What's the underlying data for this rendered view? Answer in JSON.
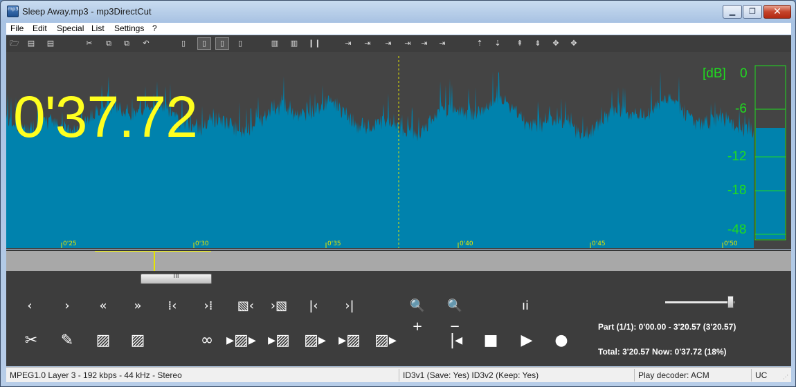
{
  "window": {
    "title": "Sleep Away.mp3 - mp3DirectCut",
    "icon_text": "mp3",
    "min_label": "▁",
    "max_label": "❐",
    "close_label": "✕"
  },
  "menu": [
    {
      "label": "File"
    },
    {
      "label": "Edit"
    },
    {
      "label": "Special"
    },
    {
      "label": "List"
    },
    {
      "label": "Settings"
    },
    {
      "label": "?"
    }
  ],
  "toolbar": [
    {
      "name": "open-icon",
      "glyph": "🗁"
    },
    {
      "name": "save-audio-icon",
      "glyph": "▤"
    },
    {
      "name": "save-list-icon",
      "glyph": "▤"
    },
    {
      "name": "cut-icon",
      "glyph": "✂"
    },
    {
      "name": "copy-icon",
      "glyph": "⧉"
    },
    {
      "name": "paste-icon",
      "glyph": "⧉"
    },
    {
      "name": "undo-icon",
      "glyph": "↶"
    },
    {
      "name": "page-icon",
      "glyph": "▯"
    },
    {
      "name": "page-mark-icon",
      "glyph": "▯"
    },
    {
      "name": "page-edit-icon",
      "glyph": "▯"
    },
    {
      "name": "page-info-icon",
      "glyph": "▯"
    },
    {
      "name": "split-many-icon",
      "glyph": "▥"
    },
    {
      "name": "split-icon",
      "glyph": "▥"
    },
    {
      "name": "pause-bars-icon",
      "glyph": "❙❙"
    },
    {
      "name": "marker-left-icon",
      "glyph": "⇥"
    },
    {
      "name": "marker-a-icon",
      "glyph": "⇥"
    },
    {
      "name": "marker-b-icon",
      "glyph": "⇥"
    },
    {
      "name": "marker-c-icon",
      "glyph": "⇥"
    },
    {
      "name": "marker-d-icon",
      "glyph": "⇥"
    },
    {
      "name": "marker-e-icon",
      "glyph": "⇥"
    },
    {
      "name": "level-up-icon",
      "glyph": "⇡"
    },
    {
      "name": "level-down-icon",
      "glyph": "⇣"
    },
    {
      "name": "nav-a-icon",
      "glyph": "⇞"
    },
    {
      "name": "nav-b-icon",
      "glyph": "⇟"
    },
    {
      "name": "nav-c-icon",
      "glyph": "✥"
    },
    {
      "name": "nav-d-icon",
      "glyph": "✥"
    }
  ],
  "waveform": {
    "color": "#0082ad",
    "background": "#444444",
    "cursor_color": "#e6e600"
  },
  "time_display": "0'37.72",
  "meter": {
    "color": "#1fdc1f",
    "unit": "[dB]",
    "labels": [
      "0",
      "-6",
      "-12",
      "-18",
      "-48"
    ]
  },
  "ruler": {
    "labels": [
      "0'25",
      "0'30",
      "0'35",
      "0'40",
      "0'45",
      "0'50"
    ]
  },
  "overview": {
    "scroll_grip": "III"
  },
  "controls_row1": [
    {
      "name": "prev-icon",
      "glyph": "‹"
    },
    {
      "name": "next-icon",
      "glyph": "›"
    },
    {
      "name": "rewind-icon",
      "glyph": "«"
    },
    {
      "name": "forward-icon",
      "glyph": "»"
    },
    {
      "name": "go-begin-selection-icon",
      "glyph": "⁞‹"
    },
    {
      "name": "go-end-selection-icon",
      "glyph": "›⁞"
    },
    {
      "name": "select-begin-icon",
      "glyph": "▧‹"
    },
    {
      "name": "select-end-icon",
      "glyph": "›▧"
    },
    {
      "name": "go-start-icon",
      "glyph": "|‹"
    },
    {
      "name": "go-end-icon",
      "glyph": "›|"
    },
    {
      "name": "zoom-in-icon",
      "glyph": "🔍+"
    },
    {
      "name": "zoom-out-icon",
      "glyph": "🔍−"
    },
    {
      "name": "info-icon",
      "glyph": "ıi"
    }
  ],
  "controls_row2": [
    {
      "name": "scissors-icon",
      "glyph": "✂"
    },
    {
      "name": "pencil-icon",
      "glyph": "✎"
    },
    {
      "name": "fade-in-icon",
      "glyph": "▨"
    },
    {
      "name": "fade-out-icon",
      "glyph": "▨"
    },
    {
      "name": "loop-icon",
      "glyph": "∞"
    },
    {
      "name": "play-selection-icon",
      "glyph": "▸▨▸"
    },
    {
      "name": "play-to-selection-icon",
      "glyph": "▸▨"
    },
    {
      "name": "play-from-selection-icon",
      "glyph": "▨▸"
    },
    {
      "name": "play-before-cut-icon",
      "glyph": "▸▨"
    },
    {
      "name": "play-after-cut-icon",
      "glyph": "▨▸"
    },
    {
      "name": "skip-back-icon",
      "glyph": "|◂"
    },
    {
      "name": "stop-icon",
      "glyph": "■"
    },
    {
      "name": "play-icon",
      "glyph": "▶"
    },
    {
      "name": "record-icon",
      "glyph": "●"
    }
  ],
  "info": {
    "part": "Part (1/1): 0'00.00 - 3'20.57 (3'20.57)",
    "total": "Total: 3'20.57   Now: 0'37.72   (18%)"
  },
  "volume": {
    "level": 0.95
  },
  "status": {
    "format": "MPEG1.0 Layer 3 - 192 kbps - 44 kHz - Stereo",
    "id3": "ID3v1 (Save: Yes)   ID3v2 (Keep: Yes)",
    "decoder": "Play decoder: ACM",
    "mode": "UC"
  }
}
